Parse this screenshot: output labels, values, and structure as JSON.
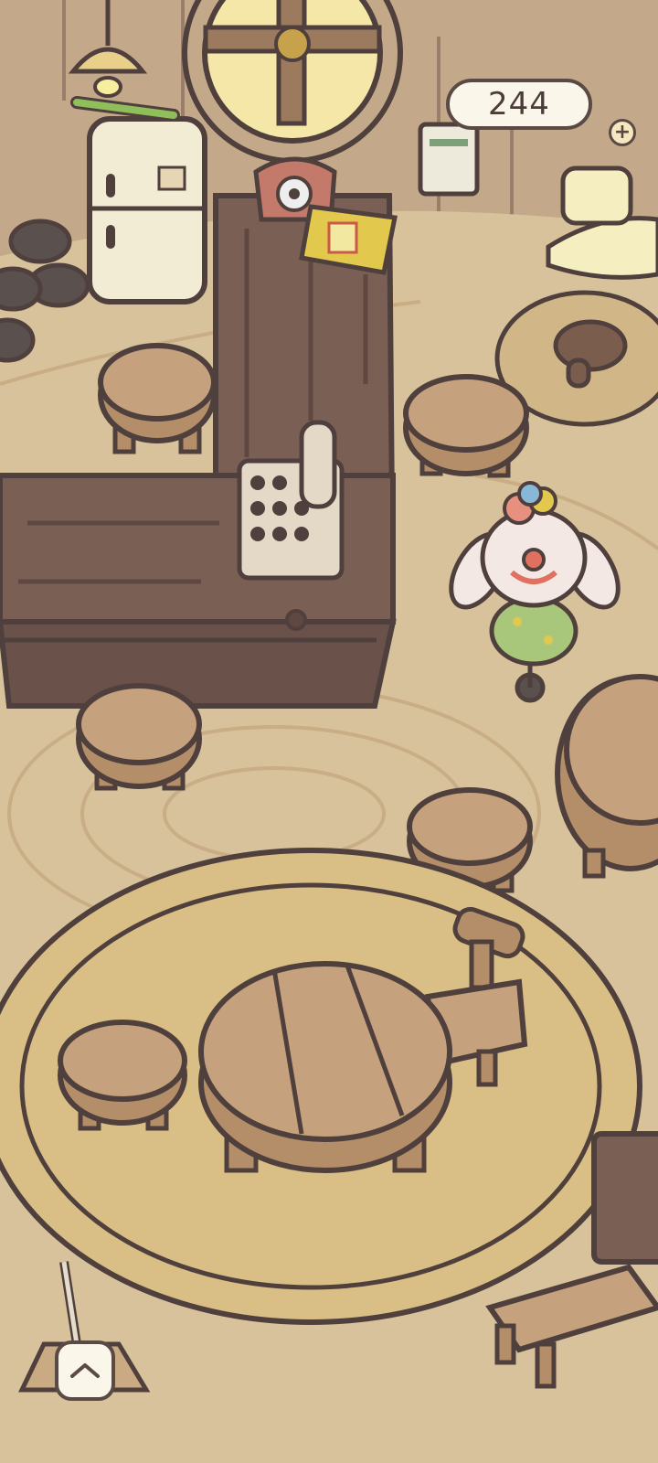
{
  "hud": {
    "currency_value": "244",
    "add_icon": "plus-icon",
    "expand_icon": "chevron-up-icon"
  },
  "colors": {
    "floor": "#d8c29c",
    "wood_dark": "#7a5f55",
    "wood_light": "#bf9a74",
    "rug": "#d9bf85",
    "outline": "#4f403d"
  }
}
